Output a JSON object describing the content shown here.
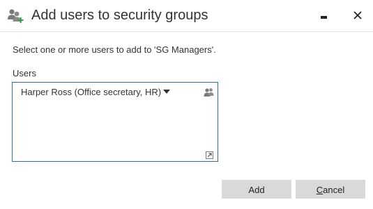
{
  "window": {
    "title": "Add users to security groups",
    "title_icon": "users-add-icon",
    "minimize_icon": "minimize-icon",
    "close_icon": "close-icon"
  },
  "instruction": "Select one or more users to add to 'SG Managers'.",
  "users_field": {
    "label": "Users",
    "selected_user": "Harper Ross (Office secretary, HR)",
    "token_dropdown_icon": "caret-down-icon",
    "address_book_icon": "address-book-icon",
    "expand_icon": "expand-icon"
  },
  "buttons": {
    "add_label": "Add",
    "cancel_label": "Cancel"
  },
  "colors": {
    "focus_border": "#2b6cb0",
    "button_bg": "#d9d9d9",
    "icon_gray": "#7a7a7a"
  }
}
